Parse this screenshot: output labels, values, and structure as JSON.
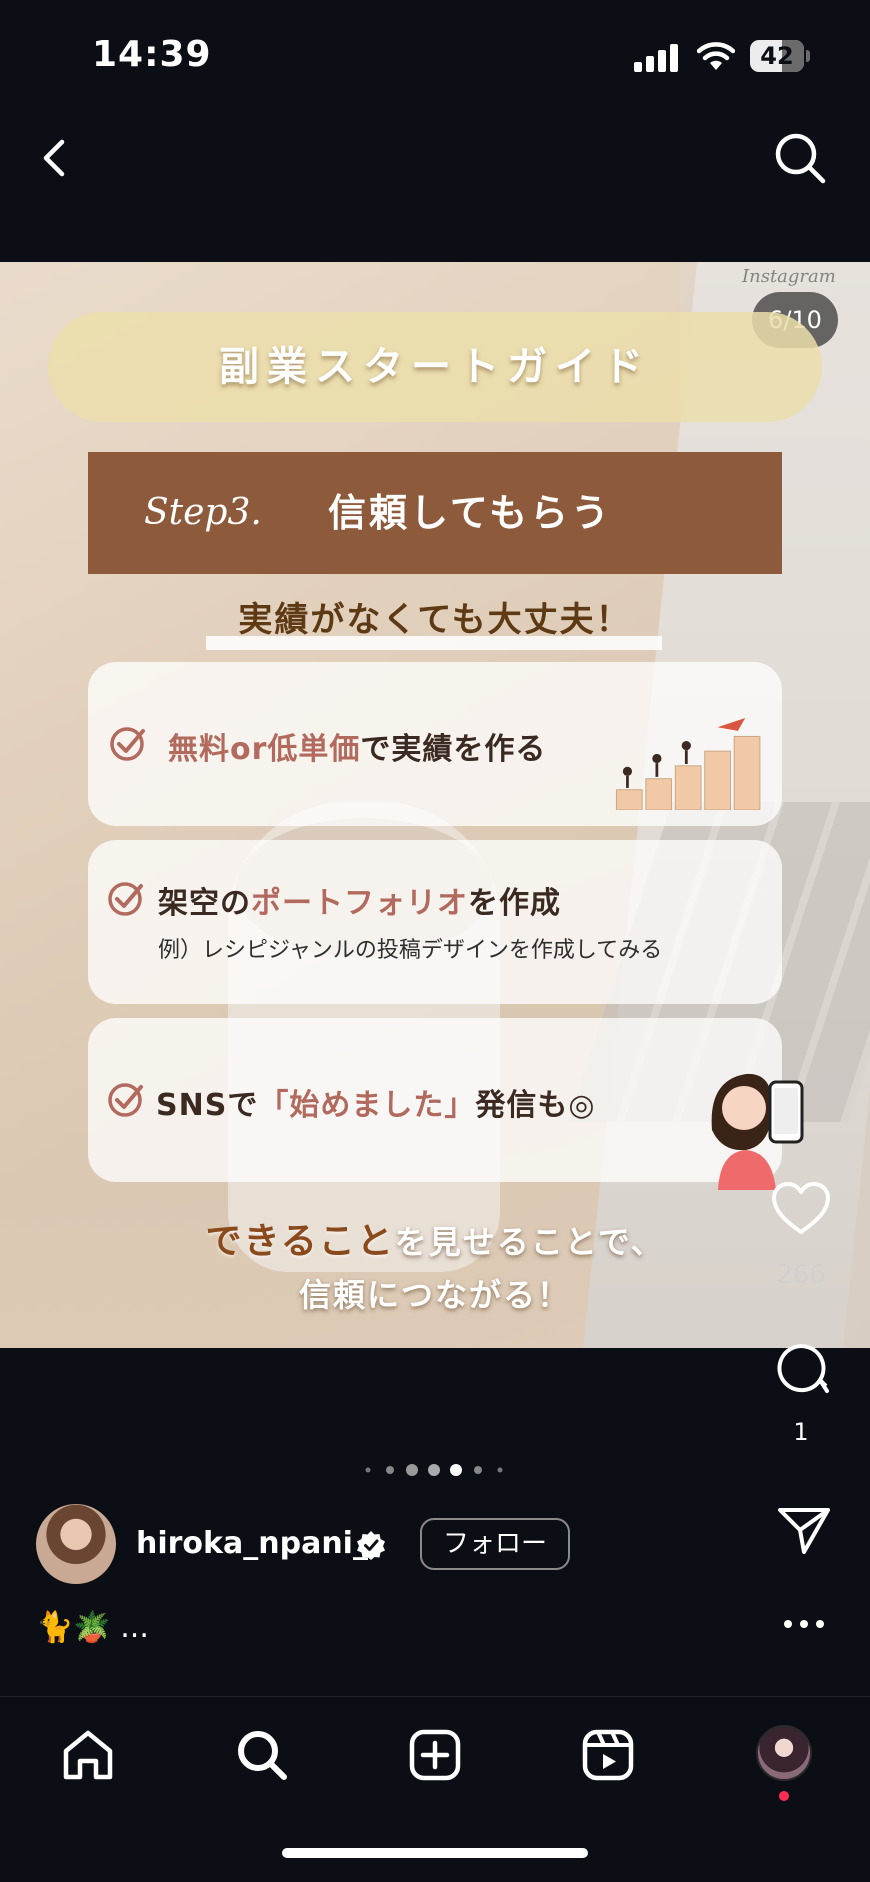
{
  "status_bar": {
    "time": "14:39",
    "battery": "42",
    "battery_level": 0.42
  },
  "post": {
    "counter": "6/10",
    "watermark": "Instagram",
    "title": "副業スタートガイド",
    "step_label": "Step3.",
    "step_title": "信頼してもらう",
    "subtitle": "実績がなくても大丈夫！",
    "items": [
      {
        "accent": "無料or低単価",
        "rest": "で実績を作る"
      },
      {
        "pre": "架空の",
        "accent": "ポートフォリオ",
        "rest": "を作成",
        "note": "例）レシピジャンルの投稿デザインを作成してみる"
      },
      {
        "pre": "SNSで",
        "accent": "「始めました」",
        "rest": "発信も◎"
      }
    ],
    "footer": {
      "highlight": "できること",
      "line1_rest": "を見せることで、",
      "line2": "信頼につながる！"
    }
  },
  "actions": {
    "like_count": "266",
    "comment_count": "1"
  },
  "pagination": {
    "total_dots": 7,
    "active_index": 3
  },
  "author": {
    "username": "hiroka_npani_",
    "follow_label": "フォロー"
  },
  "caption": {
    "emoji": "🐈🪴",
    "ellipsis": "..."
  },
  "icons": {
    "back": "chevron-left-icon",
    "search": "search-icon",
    "like": "heart-icon",
    "comment": "comment-icon",
    "share": "send-icon",
    "more": "more-icon",
    "nav": [
      "home-icon",
      "search-icon",
      "create-icon",
      "reels-icon",
      "profile-avatar"
    ]
  },
  "colors": {
    "step_bar": "#8e5a3c",
    "accent": "#b26a5e",
    "notification_dot": "#ff2d55"
  }
}
